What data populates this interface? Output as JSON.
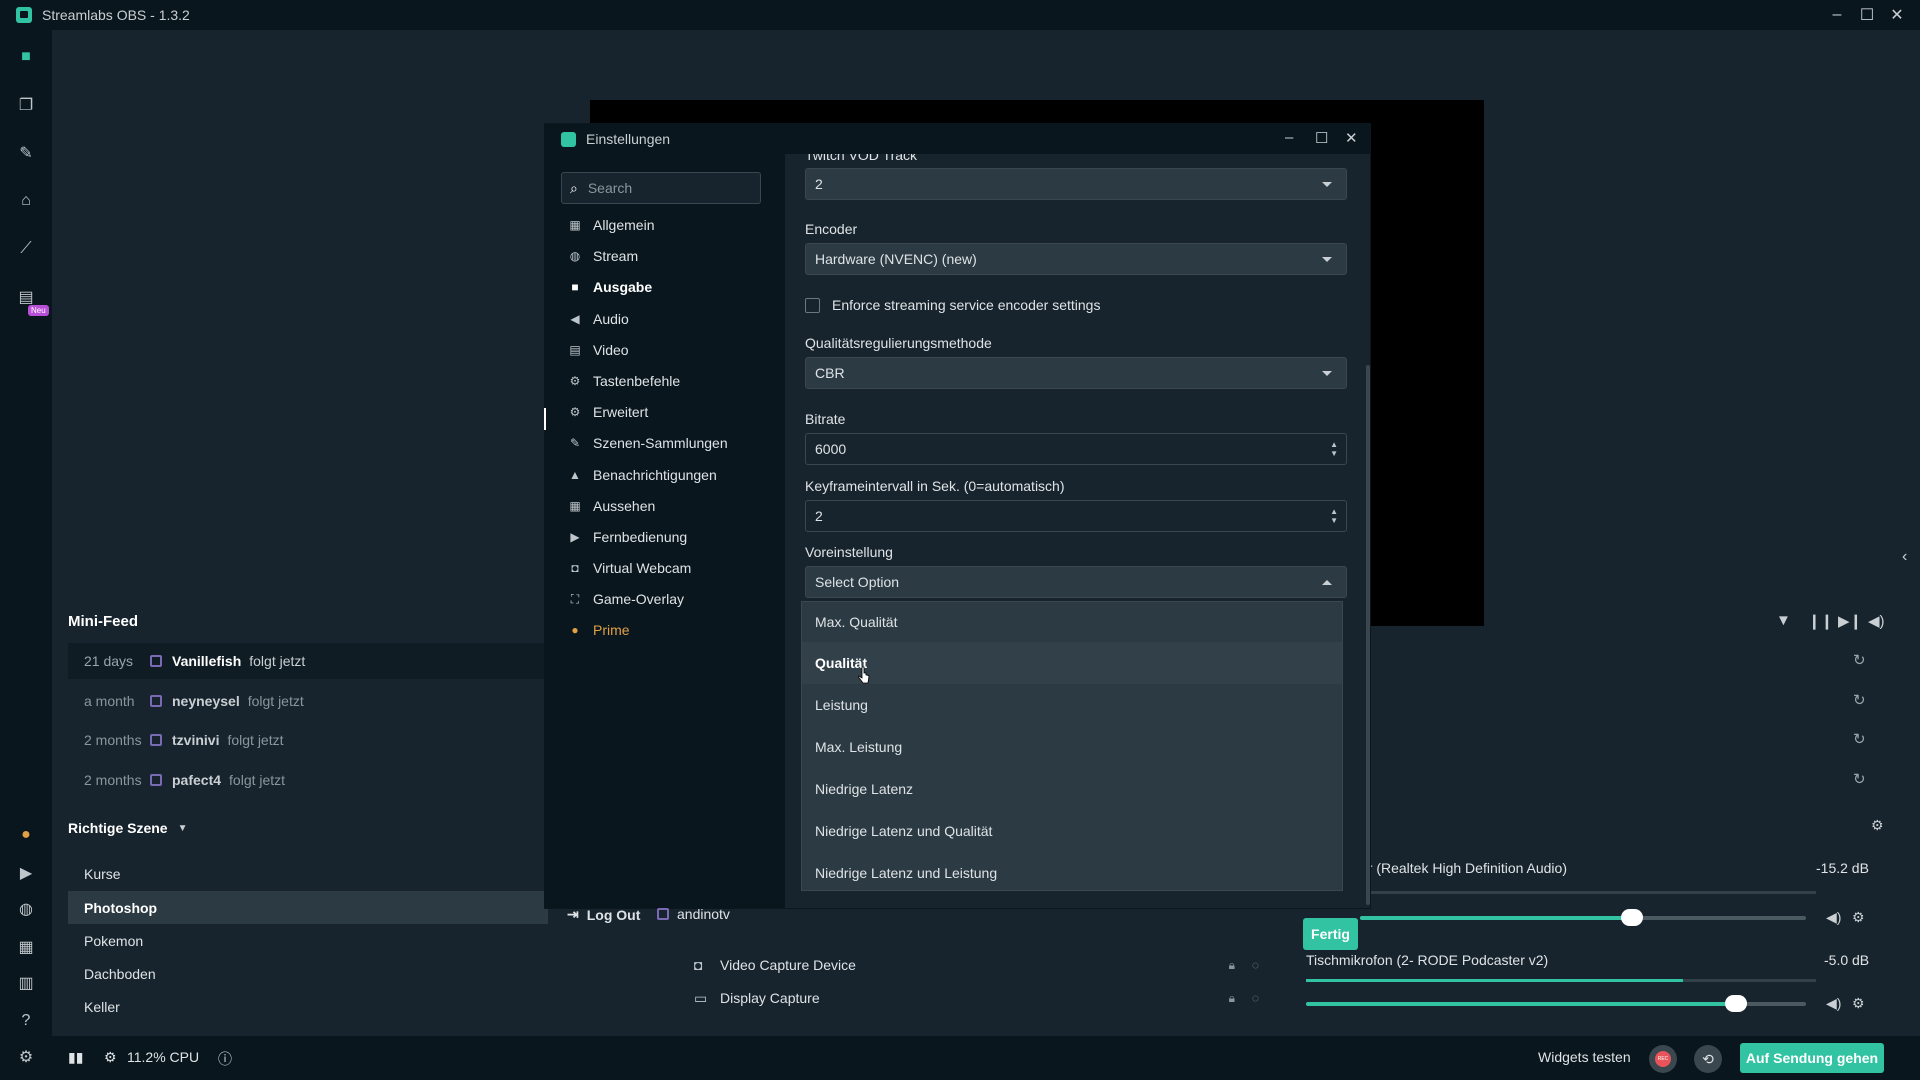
{
  "window": {
    "title": "Streamlabs OBS - 1.3.2"
  },
  "nav": {
    "neu_badge": "Neu"
  },
  "minifeed": {
    "title": "Mini-Feed",
    "items": [
      {
        "time": "21 days",
        "user": "Vanillefish",
        "action": "folgt jetzt"
      },
      {
        "time": "a month",
        "user": "neyneysel",
        "action": "folgt jetzt"
      },
      {
        "time": "2 months",
        "user": "tzvinivi",
        "action": "folgt jetzt"
      },
      {
        "time": "2 months",
        "user": "pafect4",
        "action": "folgt jetzt"
      }
    ]
  },
  "scenes": {
    "collection": "Richtige Szene",
    "items": [
      "Kurse",
      "Photoshop",
      "Pokemon",
      "Dachboden",
      "Keller"
    ],
    "selected_index": 1
  },
  "sources": {
    "items": [
      "Video Capture Device",
      "Display Capture"
    ]
  },
  "mixer": {
    "tracks": [
      {
        "name": "er (Realtek High Definition Audio)",
        "db": "-15.2 dB",
        "level": 0.0,
        "volume": 0.61
      },
      {
        "name": "Tischmikrofon (2- RODE Podcaster v2)",
        "db": "-5.0 dB",
        "level": 0.74,
        "volume": 0.86
      }
    ]
  },
  "bottombar": {
    "cpu": "11.2% CPU",
    "widgets_test": "Widgets testen",
    "rec_label": "REC",
    "go_live": "Auf Sendung gehen"
  },
  "settings": {
    "title": "Einstellungen",
    "search_placeholder": "Search",
    "categories": [
      "Allgemein",
      "Stream",
      "Ausgabe",
      "Audio",
      "Video",
      "Tastenbefehle",
      "Erweitert",
      "Szenen-Sammlungen",
      "Benachrichtigungen",
      "Aussehen",
      "Fernbedienung",
      "Virtual Webcam",
      "Game-Overlay",
      "Prime"
    ],
    "active_category": "Ausgabe",
    "logout": "Log Out",
    "account": "andinotv",
    "fields": {
      "vod_label": "Twitch VOD Track",
      "vod_value": "2",
      "encoder_label": "Encoder",
      "encoder_value": "Hardware (NVENC) (new)",
      "enforce_label": "Enforce streaming service encoder settings",
      "rate_label": "Qualitätsregulierungsmethode",
      "rate_value": "CBR",
      "bitrate_label": "Bitrate",
      "bitrate_value": "6000",
      "keyframe_label": "Keyframeintervall in Sek. (0=automatisch)",
      "keyframe_value": "2",
      "preset_label": "Voreinstellung",
      "preset_value": "Select Option"
    },
    "preset_options": [
      "Max. Qualität",
      "Qualität",
      "Leistung",
      "Max. Leistung",
      "Niedrige Latenz",
      "Niedrige Latenz und Qualität",
      "Niedrige Latenz und Leistung"
    ],
    "hover_option": "Qualität",
    "done": "Fertig"
  },
  "colors": {
    "accent": "#31c3a2",
    "bg": "#17242d",
    "panel": "#09161d",
    "prime": "#e1a046"
  }
}
